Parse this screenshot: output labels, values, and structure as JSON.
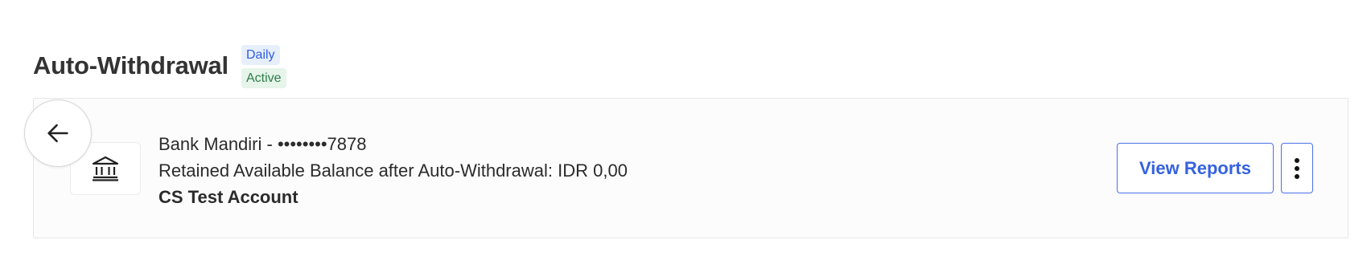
{
  "header": {
    "title": "Auto-Withdrawal",
    "frequency_badge": "Daily",
    "status_badge": "Active"
  },
  "account": {
    "bank_line": "Bank Mandiri - ••••••••7878",
    "balance_line": "Retained Available Balance after Auto-Withdrawal: IDR 0,00",
    "account_name": "CS Test Account"
  },
  "actions": {
    "view_reports_label": "View Reports"
  },
  "icons": {
    "back": "arrow-left-icon",
    "bank": "bank-icon",
    "more": "more-vertical-icon"
  },
  "colors": {
    "accent": "#3562e0",
    "badge_frequency_bg": "#e7eefc",
    "badge_status_bg": "#e6f4ea",
    "badge_status_text": "#2e7d4a"
  }
}
